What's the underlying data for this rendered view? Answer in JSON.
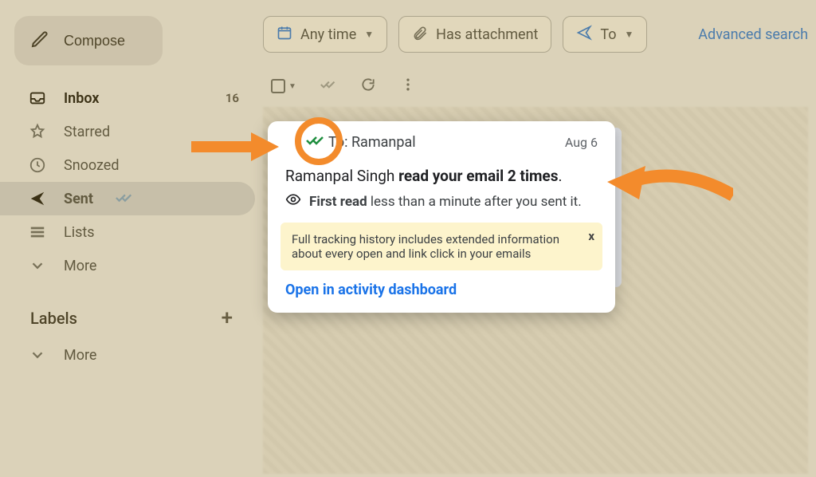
{
  "compose": {
    "label": "Compose"
  },
  "nav": {
    "inbox": {
      "label": "Inbox",
      "badge": "16"
    },
    "starred": {
      "label": "Starred"
    },
    "snoozed": {
      "label": "Snoozed"
    },
    "sent": {
      "label": "Sent"
    },
    "lists": {
      "label": "Lists"
    },
    "more": {
      "label": "More"
    }
  },
  "labels": {
    "header": "Labels",
    "more": "More"
  },
  "chips": {
    "any_time": "Any time",
    "has_attachment": "Has attachment",
    "to": "To"
  },
  "advanced_search": "Advanced search",
  "popup": {
    "to_prefix": "To: ",
    "to_name": "Ramanpal",
    "date": "Aug 6",
    "title_name": "Ramanpal Singh ",
    "title_bold": "read your email 2 times",
    "title_suffix": ".",
    "first_read_label": "First read",
    "first_read_rest": " less than a minute after you sent it.",
    "info": "Full tracking history includes extended information about every open and link click in your emails",
    "info_close": "x",
    "open_link": "Open in activity dashboard"
  }
}
